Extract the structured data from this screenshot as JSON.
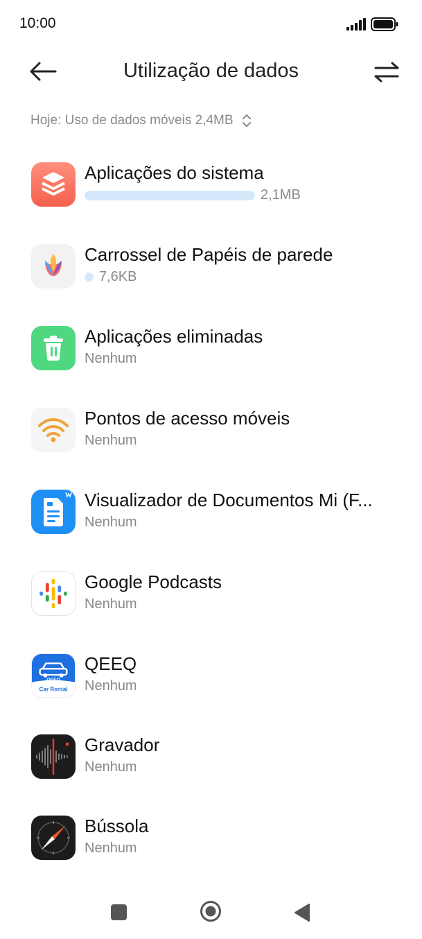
{
  "status_bar": {
    "time": "10:00",
    "signal_icon": "cellular-signal-icon",
    "battery_icon": "battery-icon"
  },
  "header": {
    "title": "Utilização de dados",
    "back_icon": "arrow-left-icon",
    "switch_icon": "swap-arrows-icon"
  },
  "filter": {
    "label": "Hoje: Uso de dados móveis 2,4MB",
    "icon": "chevron-up-down-icon"
  },
  "apps": [
    {
      "name": "Aplicações do sistema",
      "usage": "2,1MB",
      "usage_fraction": 0.87,
      "icon": "system-apps-layers-icon"
    },
    {
      "name": "Carrossel de Papéis de parede",
      "usage": "7,6KB",
      "usage_fraction": 0.003,
      "icon": "wallpaper-carousel-tulip-icon"
    },
    {
      "name": "Aplicações eliminadas",
      "usage": "Nenhum",
      "icon": "trash-icon"
    },
    {
      "name": "Pontos de acesso móveis",
      "usage": "Nenhum",
      "icon": "hotspot-wifi-icon"
    },
    {
      "name": "Visualizador de Documentos Mi (F...",
      "usage": "Nenhum",
      "icon": "document-viewer-icon"
    },
    {
      "name": "Google Podcasts",
      "usage": "Nenhum",
      "icon": "google-podcasts-icon"
    },
    {
      "name": "QEEQ",
      "usage": "Nenhum",
      "icon": "qeeq-car-icon",
      "icon_texts": [
        "QEEQ",
        "Car Rental"
      ]
    },
    {
      "name": "Gravador",
      "usage": "Nenhum",
      "icon": "recorder-waveform-icon"
    },
    {
      "name": "Bússola",
      "usage": "Nenhum",
      "icon": "compass-icon"
    }
  ],
  "nav_bar": {
    "recents_icon": "square-recents-icon",
    "home_icon": "circle-home-icon",
    "back_icon": "triangle-back-icon"
  },
  "colors": {
    "usage_bar": "#d4e8fc",
    "text_primary": "#111111",
    "text_secondary": "#8a8a8a"
  }
}
